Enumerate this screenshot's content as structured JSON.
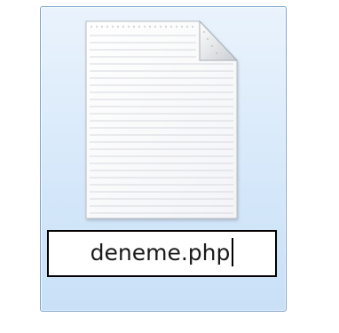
{
  "file_item": {
    "state": "selected-renaming",
    "icon": "blank-document-icon",
    "filename_input": {
      "value": "deneme.php",
      "caret_at_end": true
    }
  },
  "colors": {
    "selection_border": "#7da2ce",
    "selection_fill_top": "#eaf3fc",
    "selection_fill_bottom": "#c9e0f7",
    "input_border": "#000000"
  }
}
